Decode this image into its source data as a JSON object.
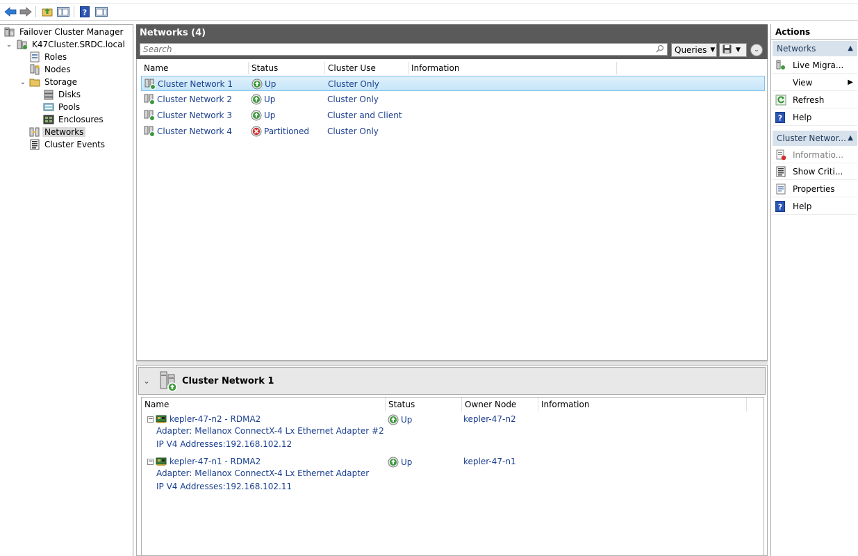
{
  "toolbar": {
    "buttons": [
      "back-icon",
      "forward-icon",
      "up-folder-icon",
      "show-hide-tree-icon",
      "help-icon",
      "show-hide-action-icon"
    ]
  },
  "tree": {
    "root": "Failover Cluster Manager",
    "cluster": "K47Cluster.SRDC.local",
    "roles": "Roles",
    "nodes": "Nodes",
    "storage": "Storage",
    "disks": "Disks",
    "pools": "Pools",
    "enclosures": "Enclosures",
    "networks": "Networks",
    "events": "Cluster Events"
  },
  "center": {
    "title": "Networks (4)",
    "search_placeholder": "Search",
    "queries_label": "Queries",
    "columns": [
      "Name",
      "Status",
      "Cluster Use",
      "Information"
    ],
    "rows": [
      {
        "name": "Cluster Network 1",
        "status": "Up",
        "use": "Cluster Only",
        "info": ""
      },
      {
        "name": "Cluster Network 2",
        "status": "Up",
        "use": "Cluster Only",
        "info": ""
      },
      {
        "name": "Cluster Network 3",
        "status": "Up",
        "use": "Cluster and Client",
        "info": ""
      },
      {
        "name": "Cluster Network 4",
        "status": "Partitioned",
        "use": "Cluster Only",
        "info": ""
      }
    ]
  },
  "details": {
    "title": "Cluster Network 1",
    "columns": [
      "Name",
      "Status",
      "Owner Node",
      "Information"
    ],
    "items": [
      {
        "name": "kepler-47-n2 - RDMA2",
        "status": "Up",
        "owner": "kepler-47-n2",
        "adapter": "Adapter: Mellanox ConnectX-4 Lx Ethernet Adapter #2",
        "ip": "IP V4 Addresses:192.168.102.12"
      },
      {
        "name": "kepler-47-n1 - RDMA2",
        "status": "Up",
        "owner": "kepler-47-n1",
        "adapter": "Adapter: Mellanox ConnectX-4 Lx Ethernet Adapter",
        "ip": "IP V4 Addresses:192.168.102.11"
      }
    ]
  },
  "actions": {
    "header": "Actions",
    "section1": "Networks",
    "s1_items": [
      "Live Migra...",
      "View",
      "Refresh",
      "Help"
    ],
    "section2": "Cluster Networ...",
    "s2_items": [
      "Informatio...",
      "Show Criti...",
      "Properties",
      "Help"
    ]
  },
  "colors": {
    "header_bg": "#5a5a5a",
    "selection": "#c6e6fa",
    "link_text": "#1a3f8f",
    "status_up": "#3a9a3a",
    "status_error": "#d0312d"
  }
}
